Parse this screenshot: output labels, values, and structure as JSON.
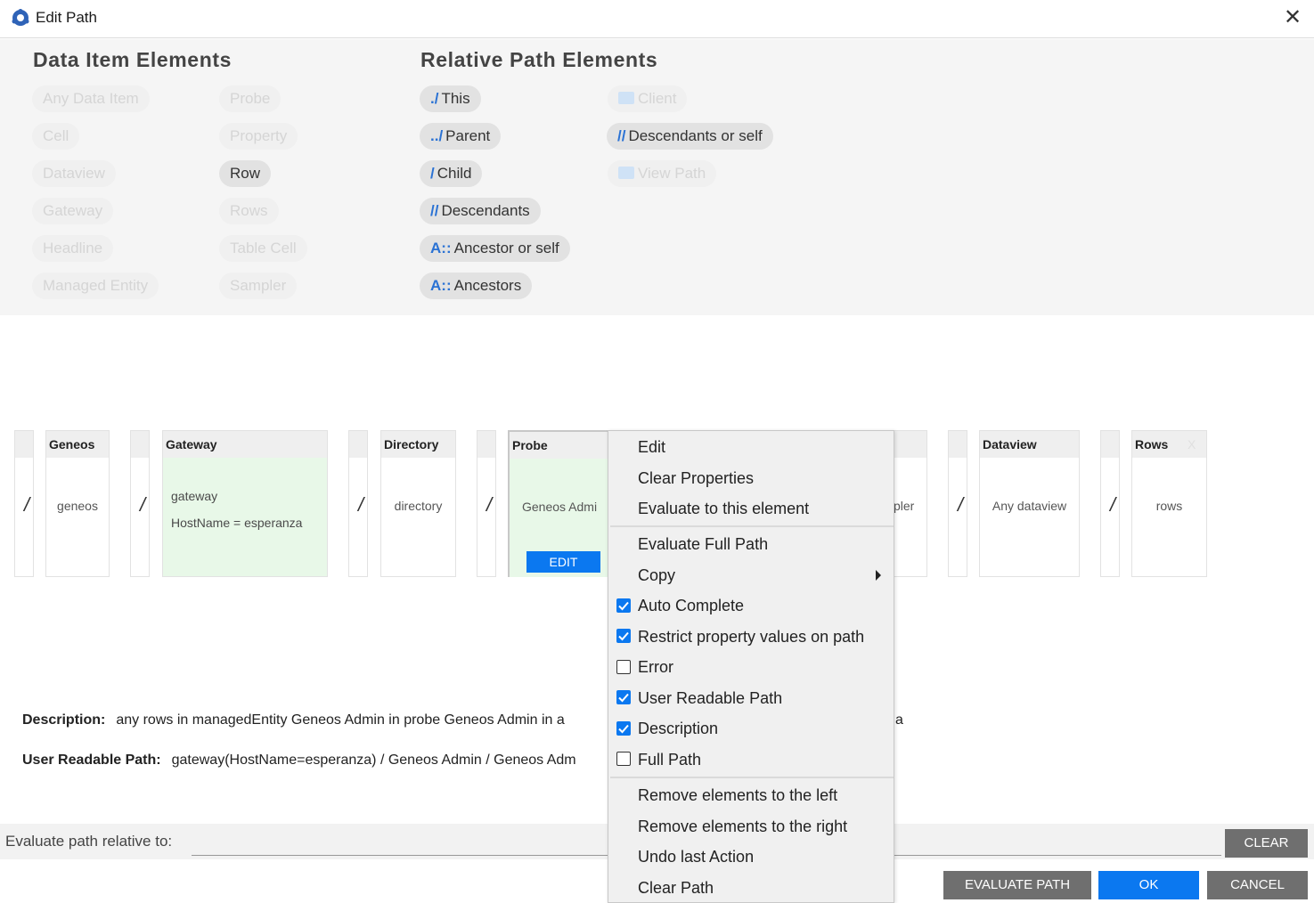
{
  "window": {
    "title": "Edit Path"
  },
  "data_item_elements": {
    "heading": "Data Item Elements",
    "items": [
      "Any Data Item",
      "Cell",
      "Dataview",
      "Gateway",
      "Headline",
      "Managed Entity",
      "Probe",
      "Property",
      "Row",
      "Rows",
      "Table Cell",
      "Sampler"
    ]
  },
  "relative_path_elements": {
    "heading": "Relative Path Elements",
    "items": [
      {
        "prefix": "./",
        "label": "This"
      },
      {
        "prefix": "../",
        "label": "Parent"
      },
      {
        "prefix": "/",
        "label": "Child"
      },
      {
        "prefix": "//",
        "label": "Descendants"
      },
      {
        "prefix": "A::",
        "label": "Ancestor or self"
      },
      {
        "prefix": "A::",
        "label": "Ancestors"
      },
      {
        "prefix": "",
        "label": "Client"
      },
      {
        "prefix": "//",
        "label": "Descendants or self"
      },
      {
        "prefix": "",
        "label": "View Path"
      }
    ]
  },
  "path": {
    "separator": "/",
    "elements": [
      {
        "header": "Geneos",
        "value": "geneos"
      },
      {
        "header": "Gateway",
        "value": "gateway",
        "property": "HostName = esperanza"
      },
      {
        "header": "Directory",
        "value": "directory"
      },
      {
        "header": "Probe",
        "value": "Geneos Admi",
        "edit_label": "EDIT"
      },
      {
        "header": "",
        "value": "pler"
      },
      {
        "header": "Dataview",
        "value": "Any dataview"
      },
      {
        "header": "Rows",
        "value": "rows",
        "close": "X"
      }
    ]
  },
  "description": {
    "label": "Description:",
    "text": "any rows in managedEntity Geneos Admin in probe Geneos Admin in a",
    "tail": "a"
  },
  "user_readable_path": {
    "label": "User Readable Path:",
    "text": "gateway(HostName=esperanza) / Geneos Admin / Geneos Adm"
  },
  "evaluate": {
    "label": "Evaluate path relative to:",
    "value": "",
    "clear_label": "CLEAR"
  },
  "footer": {
    "evaluate_path_label": "EVALUATE PATH",
    "ok_label": "OK",
    "cancel_label": "CANCEL"
  },
  "context_menu": {
    "group1": [
      "Edit",
      "Clear Properties",
      "Evaluate to this element"
    ],
    "group2": [
      "Evaluate Full Path",
      "Copy"
    ],
    "checks": [
      {
        "label": "Auto Complete",
        "checked": true
      },
      {
        "label": "Restrict property values on path",
        "checked": true
      },
      {
        "label": "Error",
        "checked": false
      },
      {
        "label": "User Readable Path",
        "checked": true
      },
      {
        "label": "Description",
        "checked": true
      },
      {
        "label": "Full Path",
        "checked": false
      }
    ],
    "group4": [
      "Remove elements to the left",
      "Remove elements to the right",
      "Undo last Action",
      "Clear Path"
    ]
  },
  "colors": {
    "accent": "#0b78f0",
    "path_prefix": "#2a72d4",
    "selected_bg": "#e8f8e8"
  }
}
